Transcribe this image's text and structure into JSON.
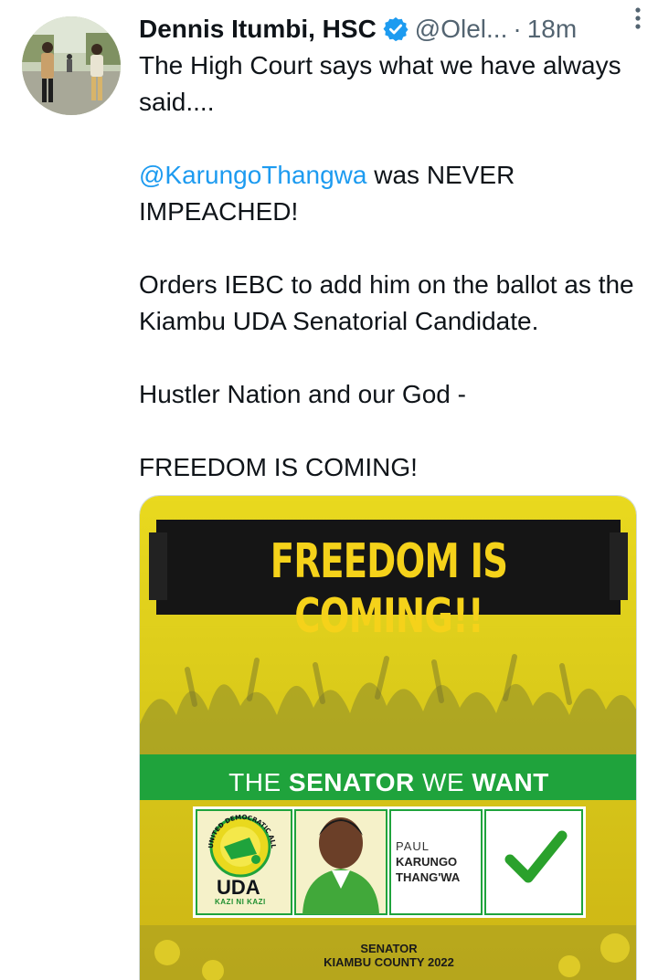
{
  "author": {
    "name": "Dennis Itumbi, HSC",
    "handle": "@Olel...",
    "separator": "·",
    "time": "18m"
  },
  "icons": {
    "verified": "verified-badge-icon",
    "more": "more-options-icon"
  },
  "colors": {
    "link": "#1d9bf0",
    "verified": "#1d9bf0",
    "poster_yellow": "#e8d61a",
    "poster_green": "#1fa33c"
  },
  "tweet": {
    "line1": "The High Court says what we have always said....",
    "mention": "@KarungoThangwa",
    "line2_rest": " was NEVER IMPEACHED!",
    "line3": "Orders IEBC to add him on the ballot as the Kiambu UDA Senatorial Candidate.",
    "line4": "Hustler Nation and our God -",
    "line5": "FREEDOM IS COMING!"
  },
  "poster": {
    "headline": "FREEDOM IS COMING!!",
    "tagline_the": "THE",
    "tagline_senator": "SENATOR",
    "tagline_we": "WE",
    "tagline_want": "WANT",
    "party_ring_text": "UNITED DEMOCRATIC ALLIANCE",
    "party_abbr": "UDA",
    "party_slogan": "KAZI NI KAZI",
    "candidate_first": "PAUL",
    "candidate_middle": "KARUNGO",
    "candidate_last": "THANG'WA",
    "footer_line1": "SENATOR",
    "footer_line2": "KIAMBU COUNTY 2022"
  }
}
